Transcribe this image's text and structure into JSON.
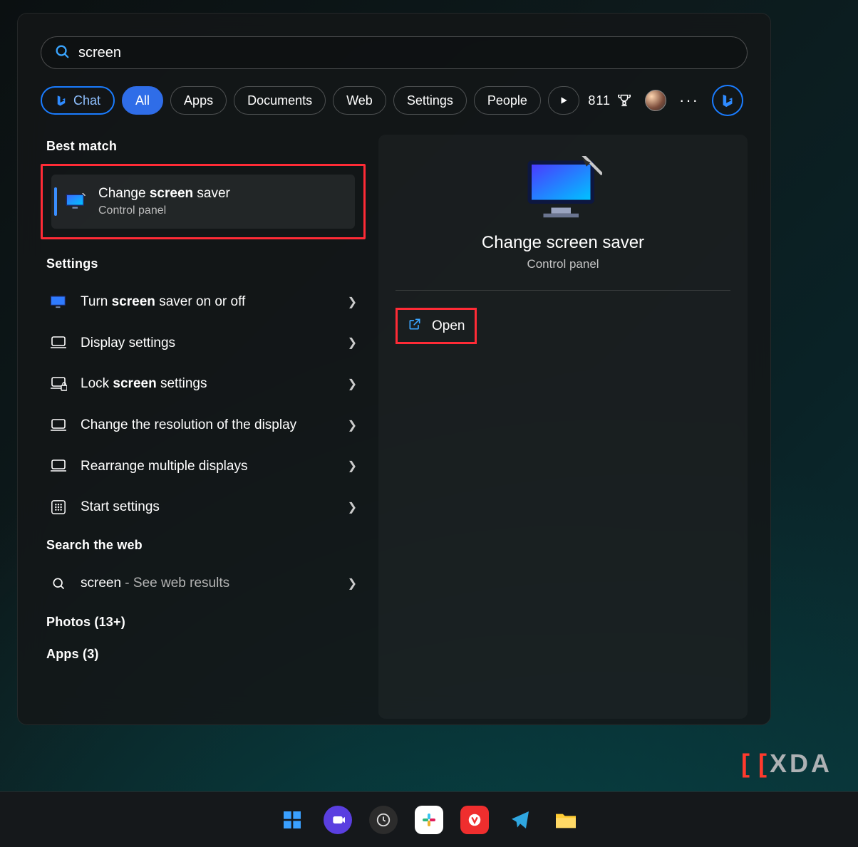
{
  "search": {
    "value": "screen"
  },
  "filters": {
    "chat": "Chat",
    "all": "All",
    "apps": "Apps",
    "documents": "Documents",
    "web": "Web",
    "settings": "Settings",
    "people": "People"
  },
  "points": "811",
  "bestMatch": {
    "header": "Best match",
    "title_pre": "Change ",
    "title_bold": "screen",
    "title_post": " saver",
    "subtitle": "Control panel"
  },
  "settingsSection": {
    "header": "Settings",
    "items": [
      {
        "icon": "monitor",
        "pre": "Turn ",
        "bold": "screen",
        "post": " saver on or off"
      },
      {
        "icon": "laptop",
        "pre": "",
        "bold": "",
        "post": "Display settings"
      },
      {
        "icon": "laptop-lock",
        "pre": "Lock ",
        "bold": "screen",
        "post": " settings"
      },
      {
        "icon": "laptop",
        "pre": "",
        "bold": "",
        "post": "Change the resolution of the display"
      },
      {
        "icon": "laptop",
        "pre": "",
        "bold": "",
        "post": "Rearrange multiple displays"
      },
      {
        "icon": "grid",
        "pre": "",
        "bold": "",
        "post": "Start settings"
      }
    ]
  },
  "webSection": {
    "header": "Search the web",
    "query": "screen",
    "suffix": " - See web results"
  },
  "extraSections": {
    "photos": "Photos (13+)",
    "apps": "Apps (3)"
  },
  "preview": {
    "title": "Change screen saver",
    "subtitle": "Control panel",
    "open": "Open"
  },
  "watermark": "XDA"
}
